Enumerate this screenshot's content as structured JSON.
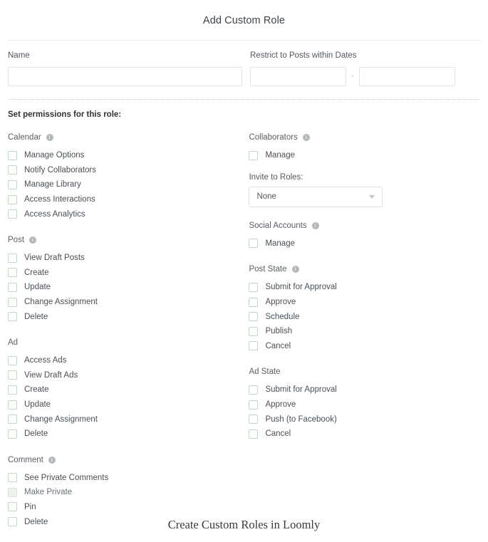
{
  "modal": {
    "title": "Add Custom Role"
  },
  "form": {
    "name": {
      "label": "Name",
      "value": "",
      "placeholder": ""
    },
    "dates": {
      "label": "Restrict to Posts within Dates",
      "separator": "-",
      "start": {
        "value": "",
        "placeholder": ""
      },
      "end": {
        "value": "",
        "placeholder": ""
      }
    }
  },
  "permissions": {
    "heading": "Set permissions for this role:",
    "left_groups": [
      {
        "title": "Calendar",
        "has_info": true,
        "items": [
          {
            "label": "Manage Options",
            "checked": false,
            "disabled": false
          },
          {
            "label": "Notify Collaborators",
            "checked": false,
            "disabled": false
          },
          {
            "label": "Manage Library",
            "checked": false,
            "disabled": false
          },
          {
            "label": "Access Interactions",
            "checked": false,
            "disabled": false
          },
          {
            "label": "Access Analytics",
            "checked": false,
            "disabled": false
          }
        ]
      },
      {
        "title": "Post",
        "has_info": true,
        "items": [
          {
            "label": "View Draft Posts",
            "checked": false,
            "disabled": false
          },
          {
            "label": "Create",
            "checked": false,
            "disabled": false
          },
          {
            "label": "Update",
            "checked": false,
            "disabled": false
          },
          {
            "label": "Change Assignment",
            "checked": false,
            "disabled": false
          },
          {
            "label": "Delete",
            "checked": false,
            "disabled": false
          }
        ]
      },
      {
        "title": "Ad",
        "has_info": false,
        "items": [
          {
            "label": "Access Ads",
            "checked": false,
            "disabled": false
          },
          {
            "label": "View Draft Ads",
            "checked": false,
            "disabled": false
          },
          {
            "label": "Create",
            "checked": false,
            "disabled": false
          },
          {
            "label": "Update",
            "checked": false,
            "disabled": false
          },
          {
            "label": "Change Assignment",
            "checked": false,
            "disabled": false
          },
          {
            "label": "Delete",
            "checked": false,
            "disabled": false
          }
        ]
      },
      {
        "title": "Comment",
        "has_info": true,
        "items": [
          {
            "label": "See Private Comments",
            "checked": false,
            "disabled": false
          },
          {
            "label": "Make Private",
            "checked": false,
            "disabled": true
          },
          {
            "label": "Pin",
            "checked": false,
            "disabled": false
          },
          {
            "label": "Delete",
            "checked": false,
            "disabled": false
          }
        ]
      }
    ],
    "right_groups": [
      {
        "title": "Collaborators",
        "has_info": true,
        "items": [
          {
            "label": "Manage",
            "checked": false,
            "disabled": false
          }
        ],
        "select": {
          "label": "Invite to Roles:",
          "value": "None",
          "options": [
            "None"
          ]
        }
      },
      {
        "title": "Social Accounts",
        "has_info": true,
        "items": [
          {
            "label": "Manage",
            "checked": false,
            "disabled": false
          }
        ]
      },
      {
        "title": "Post State",
        "has_info": true,
        "items": [
          {
            "label": "Submit for Approval",
            "checked": false,
            "disabled": false
          },
          {
            "label": "Approve",
            "checked": false,
            "disabled": false
          },
          {
            "label": "Schedule",
            "checked": false,
            "disabled": false
          },
          {
            "label": "Publish",
            "checked": false,
            "disabled": false
          },
          {
            "label": "Cancel",
            "checked": false,
            "disabled": false
          }
        ]
      },
      {
        "title": "Ad State",
        "has_info": false,
        "items": [
          {
            "label": "Submit for Approval",
            "checked": false,
            "disabled": false
          },
          {
            "label": "Approve",
            "checked": false,
            "disabled": false
          },
          {
            "label": "Push (to Facebook)",
            "checked": false,
            "disabled": false
          },
          {
            "label": "Cancel",
            "checked": false,
            "disabled": false
          }
        ]
      }
    ]
  },
  "caption": "Create Custom Roles in Loomly",
  "colors": {
    "checkbox_border": "#c4d6c4",
    "input_border": "#e3e3e3",
    "text": "#4b5055",
    "info_icon": "#b4b8bb"
  }
}
